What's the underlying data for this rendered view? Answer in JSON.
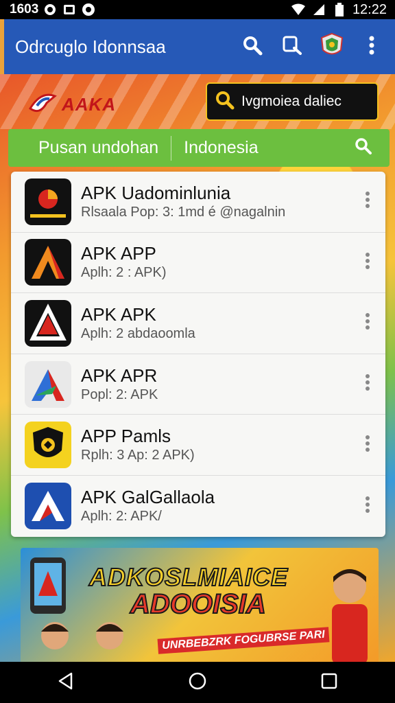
{
  "status_bar": {
    "left_text": "1603",
    "time": "12:22"
  },
  "app_bar": {
    "title": "Odrcuglo Idonnsaa"
  },
  "hero": {
    "brand_text": "AAKA",
    "search_text": "Ivgmoiea daliec",
    "accent": "#f4c21f"
  },
  "tabs": [
    {
      "label": "Pusan undohan"
    },
    {
      "label": "Indonesia"
    }
  ],
  "apps": [
    {
      "title": "APK Uadominlunia",
      "subtitle": "Rlsaala Pop: 3: 1md é @nagalnin",
      "icon": "red-circle-app-icon"
    },
    {
      "title": "APK APP",
      "subtitle": "Aplh: 2 : APK)",
      "icon": "orange-a-app-icon"
    },
    {
      "title": "APK APK",
      "subtitle": "Aplh: 2 abdaoomla",
      "icon": "red-a-app-icon"
    },
    {
      "title": "APK APR",
      "subtitle": "Popl: 2: APK",
      "icon": "multicolor-a-app-icon"
    },
    {
      "title": "APP Pamls",
      "subtitle": "Rplh: 3 Ap: 2 APK)",
      "icon": "shield-app-icon"
    },
    {
      "title": "APK GalGallaola",
      "subtitle": "Aplh: 2: APK/",
      "icon": "blue-a-app-icon"
    }
  ],
  "promo": {
    "headline": "ADKOSLMIAICE",
    "subheadline": "ADOOISIA",
    "tag": "UNRBEBZRK FOGUBRSE PARI"
  },
  "colors": {
    "app_bar": "#2659b7",
    "tab_bar": "#6cbf3f",
    "status_bar": "#000000"
  }
}
